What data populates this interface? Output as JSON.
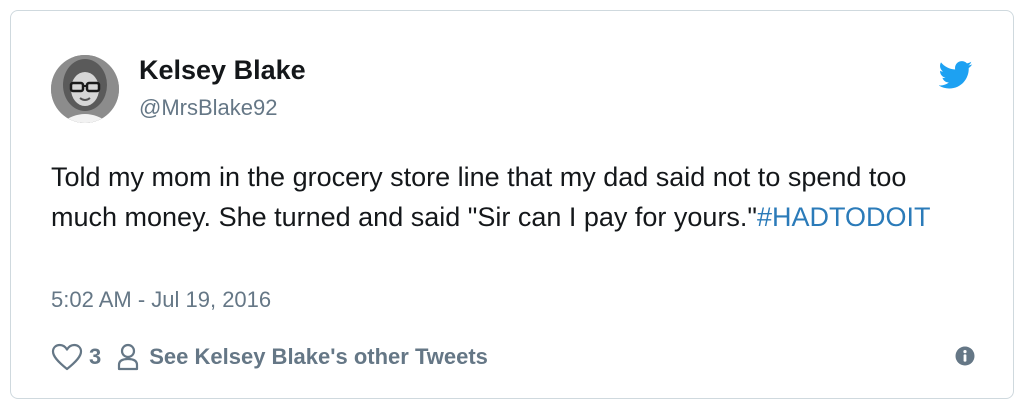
{
  "author": {
    "name": "Kelsey Blake",
    "handle": "@MrsBlake92",
    "avatar_icon": "profile-photo"
  },
  "tweet": {
    "text": "Told my mom in the grocery store line that my dad said not to spend too much money. She turned and said \"Sir can I pay for yours.\"",
    "hashtag": "#HADTODOIT",
    "timestamp": "5:02 AM - Jul 19, 2016"
  },
  "actions": {
    "like_count": "3",
    "other_tweets_label": "See Kelsey Blake's other Tweets"
  },
  "icons": {
    "brand": "twitter-bird-icon",
    "like": "heart-icon",
    "profile": "person-icon",
    "info": "info-icon"
  },
  "colors": {
    "twitter_blue": "#1da1f2",
    "link_blue": "#2b7bb9",
    "secondary_text": "#657786",
    "primary_text": "#14171a"
  }
}
